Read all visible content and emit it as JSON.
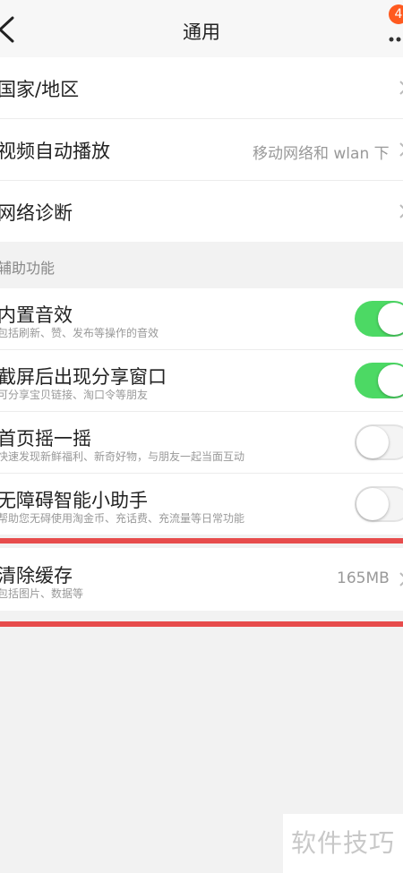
{
  "header": {
    "title": "通用",
    "badge": "4"
  },
  "rows_top": [
    {
      "label": "国家/地区",
      "value": ""
    },
    {
      "label": "视频自动播放",
      "value": "移动网络和 wlan 下"
    },
    {
      "label": "网络诊断",
      "value": ""
    }
  ],
  "section": {
    "label": "辅助功能"
  },
  "toggles": [
    {
      "label": "内置音效",
      "sub": "包括刷新、赞、发布等操作的音效",
      "state": "on"
    },
    {
      "label": "截屏后出现分享窗口",
      "sub": "可分享宝贝链接、淘口令等朋友",
      "state": "on"
    },
    {
      "label": "首页摇一摇",
      "sub": "快速发现新鲜福利、新奇好物，与朋友一起当面互动",
      "state": "off"
    },
    {
      "label": "无障碍智能小助手",
      "sub": "帮助您无碍使用淘金币、充话费、充流量等日常功能",
      "state": "off"
    }
  ],
  "cache": {
    "label": "清除缓存",
    "sub": "包括图片、数据等",
    "value": "165MB"
  },
  "watermark": "软件技巧",
  "colors": {
    "toggle_on": "#4cd964",
    "highlight": "#e74c4c",
    "badge": "#ff5a1f"
  },
  "icons": {
    "back": "chevron-left-icon",
    "more": "more-dots-icon",
    "row_arrow": "chevron-right-icon"
  }
}
